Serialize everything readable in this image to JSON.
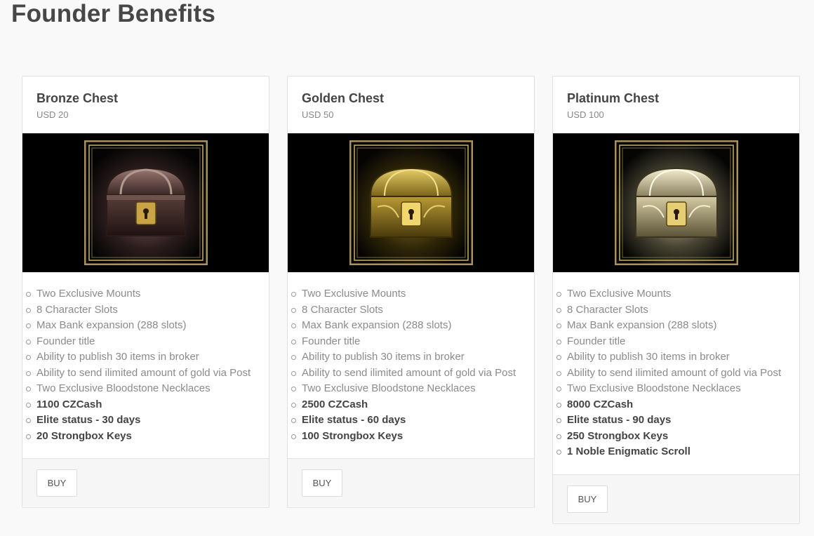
{
  "page": {
    "title": "Founder Benefits"
  },
  "colors": {
    "bronze": "#8a5a4c",
    "gold": "#c9a43a",
    "platinum": "#d8d0b0",
    "frame": "#b09a5a"
  },
  "cards": [
    {
      "title": "Bronze Chest",
      "price": "USD 20",
      "image_icon": "bronze-chest-icon",
      "features": [
        "Two Exclusive Mounts",
        "8 Character Slots",
        "Max Bank expansion (288 slots)",
        "Founder title",
        "Ability to publish 30 items in broker",
        "Ability to send ilimited amount of gold via Post",
        "Two Exclusive Bloodstone Necklaces"
      ],
      "bold_features": [
        "1100 CZCash",
        "Elite status - 30 days",
        "20 Strongbox Keys"
      ],
      "button": "BUY"
    },
    {
      "title": "Golden Chest",
      "price": "USD 50",
      "image_icon": "golden-chest-icon",
      "features": [
        "Two Exclusive Mounts",
        "8 Character Slots",
        "Max Bank expansion (288 slots)",
        "Founder title",
        "Ability to publish 30 items in broker",
        "Ability to send ilimited amount of gold via Post",
        "Two Exclusive Bloodstone Necklaces"
      ],
      "bold_features": [
        "2500 CZCash",
        "Elite status - 60 days",
        "100 Strongbox Keys"
      ],
      "button": "BUY"
    },
    {
      "title": "Platinum Chest",
      "price": "USD 100",
      "image_icon": "platinum-chest-icon",
      "features": [
        "Two Exclusive Mounts",
        "8 Character Slots",
        "Max Bank expansion (288 slots)",
        "Founder title",
        "Ability to publish 30 items in broker",
        "Ability to send ilimited amount of gold via Post",
        "Two Exclusive Bloodstone Necklaces"
      ],
      "bold_features": [
        "8000 CZCash",
        "Elite status - 90 days",
        "250 Strongbox Keys",
        "1 Noble Enigmatic Scroll"
      ],
      "button": "BUY"
    }
  ]
}
